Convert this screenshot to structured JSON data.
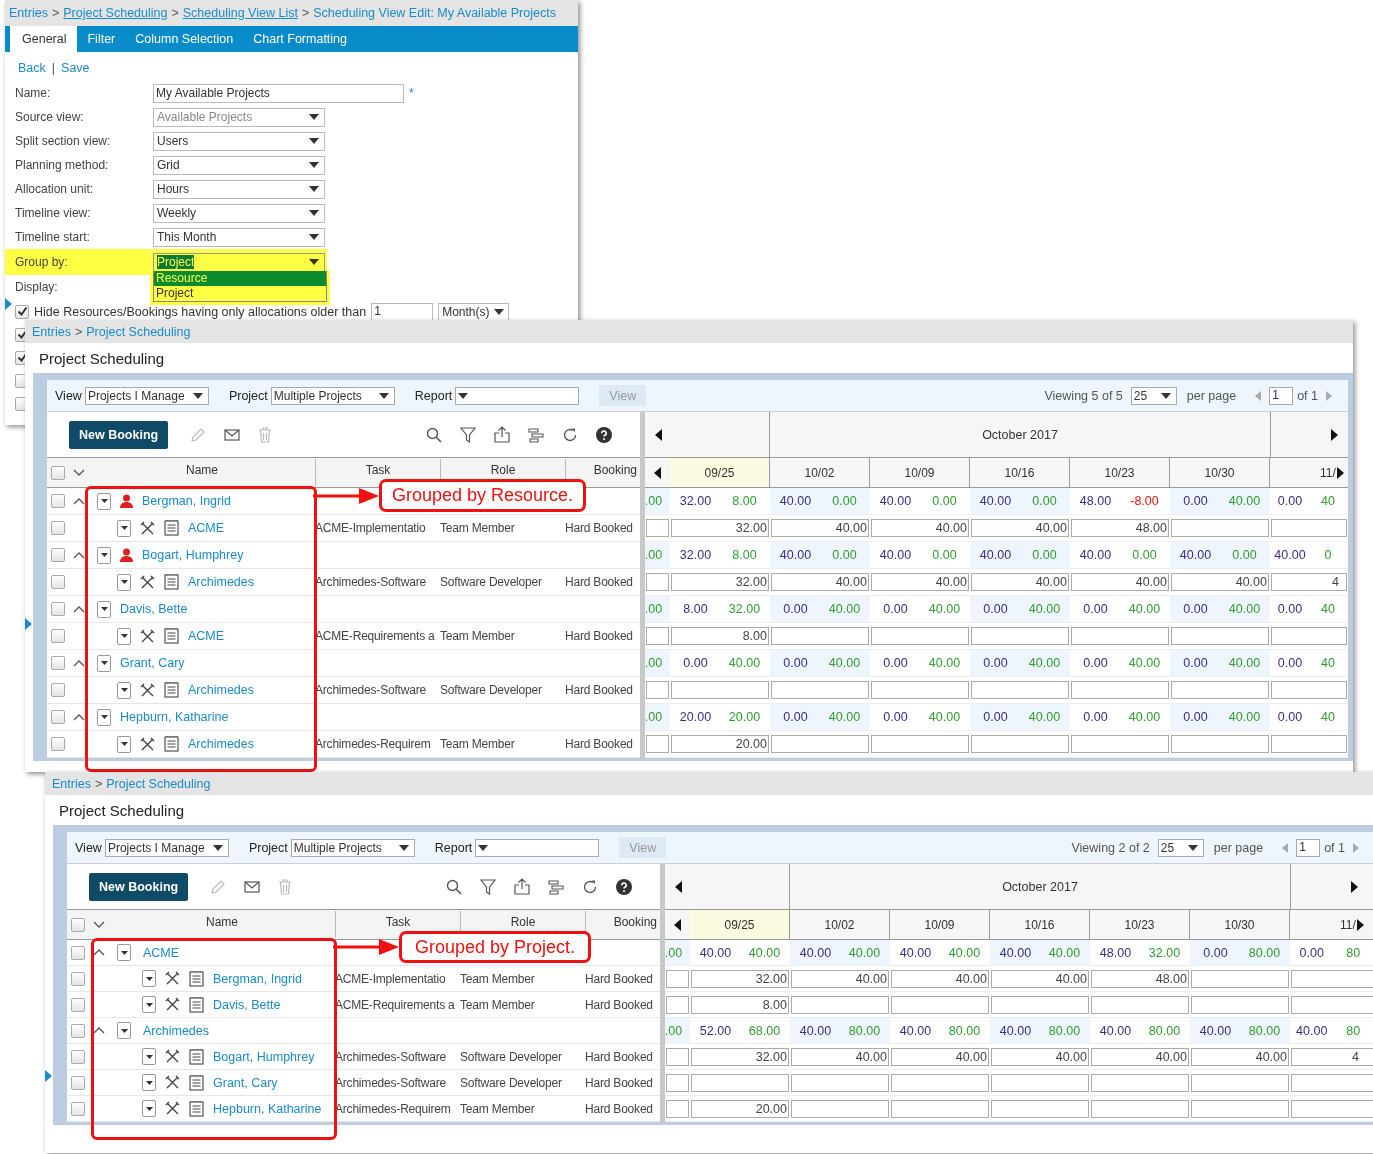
{
  "settings": {
    "breadcrumb": {
      "separator": ">",
      "items": [
        {
          "label": "Entries",
          "underlined": false
        },
        {
          "label": "Project Scheduling",
          "underlined": true
        },
        {
          "label": "Scheduling View List",
          "underlined": true
        },
        {
          "label": "Scheduling View Edit: My Available Projects",
          "underlined": false
        }
      ]
    },
    "tabs": [
      {
        "label": "General",
        "selected": true
      },
      {
        "label": "Filter",
        "selected": false
      },
      {
        "label": "Column Selection",
        "selected": false
      },
      {
        "label": "Chart Formatting",
        "selected": false
      }
    ],
    "actions": {
      "links": [
        "Back",
        "Save"
      ],
      "separator": "|"
    },
    "fields": [
      {
        "kind": "text",
        "label": "Name:",
        "value": "My Available Projects",
        "required": "*"
      },
      {
        "kind": "select",
        "label": "Source view:",
        "value": "Available Projects",
        "disabled": true,
        "highlighted": false,
        "open": false
      },
      {
        "kind": "select",
        "label": "Split section view:",
        "value": "Users",
        "disabled": false,
        "highlighted": false,
        "open": false
      },
      {
        "kind": "select",
        "label": "Planning method:",
        "value": "Grid",
        "disabled": false,
        "highlighted": false,
        "open": false
      },
      {
        "kind": "select",
        "label": "Allocation unit:",
        "value": "Hours",
        "disabled": false,
        "highlighted": false,
        "open": false
      },
      {
        "kind": "select",
        "label": "Timeline view:",
        "value": "Weekly",
        "disabled": false,
        "highlighted": false,
        "open": false
      },
      {
        "kind": "select",
        "label": "Timeline start:",
        "value": "This Month",
        "disabled": false,
        "highlighted": false,
        "open": false
      },
      {
        "kind": "select",
        "label": "Group by:",
        "value": "Project",
        "disabled": false,
        "highlighted": true,
        "open": true,
        "options": [
          {
            "label": "Resource",
            "highlighted": true
          },
          {
            "label": "Project",
            "highlighted": false
          }
        ]
      },
      {
        "kind": "label",
        "label": "Display:"
      }
    ],
    "options": [
      {
        "checked": true,
        "label": "Hide Resources/Bookings having only allocations older than",
        "amount": "1",
        "unit": "Month(s)"
      },
      {
        "checked": true
      },
      {
        "checked": true
      },
      {
        "checked": false
      },
      {
        "checked": false
      }
    ]
  },
  "schedules": [
    {
      "breadcrumb": {
        "separator": ">",
        "items": [
          "Entries",
          "Project Scheduling"
        ]
      },
      "title": "Project Scheduling",
      "filters": [
        {
          "label": "View",
          "value": "Projects I Manage"
        },
        {
          "label": "Project",
          "value": "Multiple Projects"
        },
        {
          "label": "Report"
        }
      ],
      "view_button": {
        "label": "View",
        "disabled": true
      },
      "viewing": "Viewing 5 of 5",
      "page_size": "25",
      "per_page": "per page",
      "page": "1",
      "page_count": "of 1",
      "new_booking": "New Booking",
      "all_checked": false,
      "columns": [
        "Name",
        "Task",
        "Role",
        "Booking"
      ],
      "month": "October 2017",
      "weeks": [
        {
          "label": "09/25",
          "current": true
        },
        {
          "label": "10/02",
          "current": false
        },
        {
          "label": "10/09",
          "current": false
        },
        {
          "label": "10/16",
          "current": false
        },
        {
          "label": "10/23",
          "current": false
        },
        {
          "label": "10/30",
          "current": false
        },
        {
          "label": "11/",
          "current": false
        }
      ],
      "callout": "Grouped by Resource.",
      "rows": [
        {
          "kind": "group",
          "name": "Bergman, Ingrid",
          "person": true,
          "expanded": true,
          "checked": false,
          "lead": ".00",
          "values": [
            [
              "32.00",
              "8.00"
            ],
            [
              "40.00",
              "0.00"
            ],
            [
              "40.00",
              "0.00"
            ],
            [
              "40.00",
              "0.00"
            ],
            [
              "48.00",
              "-8.00"
            ],
            [
              "0.00",
              "40.00"
            ],
            [
              "0.00",
              "40"
            ]
          ]
        },
        {
          "kind": "detail",
          "name": "ACME",
          "task": "ACME-Implementatio",
          "role": "Team Member",
          "booking": "Hard Booked",
          "checked": false,
          "hours": [
            "32.00",
            "40.00",
            "40.00",
            "40.00",
            "48.00"
          ]
        },
        {
          "kind": "group",
          "name": "Bogart, Humphrey",
          "person": true,
          "expanded": true,
          "checked": false,
          "lead": ".00",
          "values": [
            [
              "32.00",
              "8.00"
            ],
            [
              "40.00",
              "0.00"
            ],
            [
              "40.00",
              "0.00"
            ],
            [
              "40.00",
              "0.00"
            ],
            [
              "40.00",
              "0.00"
            ],
            [
              "40.00",
              "0.00"
            ],
            [
              "40.00",
              "0"
            ]
          ]
        },
        {
          "kind": "detail",
          "name": "Archimedes",
          "task": "Archimedes-Software",
          "role": "Software Developer",
          "booking": "Hard Booked",
          "checked": false,
          "hours": [
            "32.00",
            "40.00",
            "40.00",
            "40.00",
            "40.00",
            "40.00",
            "4"
          ]
        },
        {
          "kind": "group",
          "name": "Davis, Bette",
          "person": false,
          "expanded": true,
          "checked": false,
          "lead": ".00",
          "values": [
            [
              "8.00",
              "32.00"
            ],
            [
              "0.00",
              "40.00"
            ],
            [
              "0.00",
              "40.00"
            ],
            [
              "0.00",
              "40.00"
            ],
            [
              "0.00",
              "40.00"
            ],
            [
              "0.00",
              "40.00"
            ],
            [
              "0.00",
              "40"
            ]
          ]
        },
        {
          "kind": "detail",
          "name": "ACME",
          "task": "ACME-Requirements a",
          "role": "Team Member",
          "booking": "Hard Booked",
          "checked": false,
          "hours": [
            "8.00"
          ]
        },
        {
          "kind": "group",
          "name": "Grant, Cary",
          "person": false,
          "expanded": true,
          "checked": false,
          "lead": ".00",
          "values": [
            [
              "0.00",
              "40.00"
            ],
            [
              "0.00",
              "40.00"
            ],
            [
              "0.00",
              "40.00"
            ],
            [
              "0.00",
              "40.00"
            ],
            [
              "0.00",
              "40.00"
            ],
            [
              "0.00",
              "40.00"
            ],
            [
              "0.00",
              "40"
            ]
          ]
        },
        {
          "kind": "detail",
          "name": "Archimedes",
          "task": "Archimedes-Software",
          "role": "Software Developer",
          "booking": "Hard Booked",
          "checked": false
        },
        {
          "kind": "group",
          "name": "Hepburn, Katharine",
          "person": false,
          "expanded": true,
          "checked": false,
          "lead": ".00",
          "values": [
            [
              "20.00",
              "20.00"
            ],
            [
              "0.00",
              "40.00"
            ],
            [
              "0.00",
              "40.00"
            ],
            [
              "0.00",
              "40.00"
            ],
            [
              "0.00",
              "40.00"
            ],
            [
              "0.00",
              "40.00"
            ],
            [
              "0.00",
              "40"
            ]
          ]
        },
        {
          "kind": "detail",
          "name": "Archimedes",
          "task": "Archimedes-Requirem",
          "role": "Team Member",
          "booking": "Hard Booked",
          "checked": false,
          "hours": [
            "20.00"
          ]
        }
      ]
    },
    {
      "breadcrumb": {
        "separator": ">",
        "items": [
          "Entries",
          "Project Scheduling"
        ]
      },
      "title": "Project Scheduling",
      "filters": [
        {
          "label": "View",
          "value": "Projects I Manage"
        },
        {
          "label": "Project",
          "value": "Multiple Projects"
        },
        {
          "label": "Report"
        }
      ],
      "view_button": {
        "label": "View",
        "disabled": true
      },
      "viewing": "Viewing 2 of 2",
      "page_size": "25",
      "per_page": "per page",
      "page": "1",
      "page_count": "of 1",
      "new_booking": "New Booking",
      "all_checked": false,
      "columns": [
        "Name",
        "Task",
        "Role",
        "Booking"
      ],
      "month": "October 2017",
      "weeks": [
        {
          "label": "09/25",
          "current": true
        },
        {
          "label": "10/02",
          "current": false
        },
        {
          "label": "10/09",
          "current": false
        },
        {
          "label": "10/16",
          "current": false
        },
        {
          "label": "10/23",
          "current": false
        },
        {
          "label": "10/30",
          "current": false
        },
        {
          "label": "11/",
          "current": false
        }
      ],
      "callout": "Grouped by Project.",
      "rows": [
        {
          "kind": "group",
          "name": "ACME",
          "person": false,
          "expanded": true,
          "checked": false,
          "lead": ".00",
          "values": [
            [
              "40.00",
              "40.00"
            ],
            [
              "40.00",
              "40.00"
            ],
            [
              "40.00",
              "40.00"
            ],
            [
              "40.00",
              "40.00"
            ],
            [
              "48.00",
              "32.00"
            ],
            [
              "0.00",
              "80.00"
            ],
            [
              "0.00",
              "80"
            ]
          ]
        },
        {
          "kind": "detail",
          "name": "Bergman, Ingrid",
          "task": "ACME-Implementatio",
          "role": "Team Member",
          "booking": "Hard Booked",
          "checked": false,
          "hours": [
            "32.00",
            "40.00",
            "40.00",
            "40.00",
            "48.00"
          ]
        },
        {
          "kind": "detail",
          "name": "Davis, Bette",
          "task": "ACME-Requirements a",
          "role": "Team Member",
          "booking": "Hard Booked",
          "checked": false,
          "hours": [
            "8.00"
          ]
        },
        {
          "kind": "group",
          "name": "Archimedes",
          "person": false,
          "expanded": true,
          "checked": false,
          "lead": ".00",
          "values": [
            [
              "52.00",
              "68.00"
            ],
            [
              "40.00",
              "80.00"
            ],
            [
              "40.00",
              "80.00"
            ],
            [
              "40.00",
              "80.00"
            ],
            [
              "40.00",
              "80.00"
            ],
            [
              "40.00",
              "80.00"
            ],
            [
              "40.00",
              "80"
            ]
          ]
        },
        {
          "kind": "detail",
          "name": "Bogart, Humphrey",
          "task": "Archimedes-Software",
          "role": "Software Developer",
          "booking": "Hard Booked",
          "checked": false,
          "hours": [
            "32.00",
            "40.00",
            "40.00",
            "40.00",
            "40.00",
            "40.00",
            "4"
          ]
        },
        {
          "kind": "detail",
          "name": "Grant, Cary",
          "task": "Archimedes-Software",
          "role": "Software Developer",
          "booking": "Hard Booked",
          "checked": false
        },
        {
          "kind": "detail",
          "name": "Hepburn, Katharine",
          "task": "Archimedes-Requirem",
          "role": "Team Member",
          "booking": "Hard Booked",
          "checked": false,
          "hours": [
            "20.00"
          ]
        }
      ]
    }
  ]
}
